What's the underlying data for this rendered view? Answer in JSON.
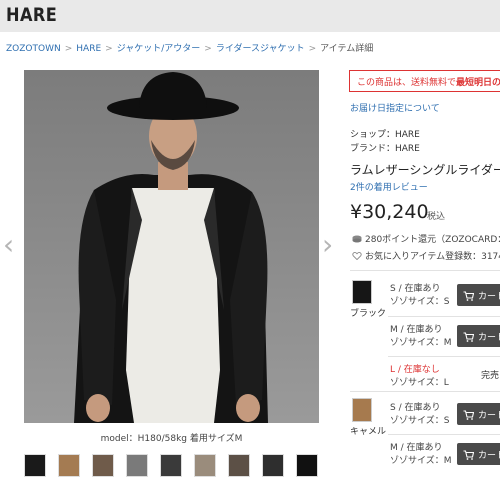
{
  "header": {
    "logo": "HARE"
  },
  "breadcrumb": {
    "items": [
      "ZOZOTOWN",
      "HARE",
      "ジャケット/アウター",
      "ライダースジャケット"
    ],
    "current": "アイテム詳細",
    "separator": ">"
  },
  "gallery": {
    "prev_icon": "chevron-left-icon",
    "next_icon": "chevron-right-icon",
    "caption": "model：H180/58kg 着用サイズM",
    "thumbnail_count": 9
  },
  "product": {
    "notice_prefix": "この商品は、送料無料で",
    "notice_bold": "最短明日のお",
    "delivery_link": "お届け日指定について",
    "shop_line": "ショップ：HARE",
    "brand_line": "ブランド：HARE",
    "name": "ラムレザーシングルライダース",
    "review_link": "2件の着用レビュー",
    "price": "¥30,240",
    "tax_label": "税込",
    "points": "280ポイント還元（ZOZOCARD：",
    "favorites": "お気に入りアイテム登録数：3174"
  },
  "variants": [
    {
      "color": "ブラック",
      "sizes": [
        {
          "status": "S / 在庫あり",
          "size": "ゾゾサイズ：S",
          "action": "カート"
        },
        {
          "status": "M / 在庫あり",
          "size": "ゾゾサイズ：M",
          "action": "カート"
        },
        {
          "status": "L / 在庫なし",
          "size": "ゾゾサイズ：L",
          "action": "完売"
        }
      ]
    },
    {
      "color": "キャメル",
      "sizes": [
        {
          "status": "S / 在庫あり",
          "size": "ゾゾサイズ：S",
          "action": "カート"
        },
        {
          "status": "M / 在庫あり",
          "size": "ゾゾサイズ：M",
          "action": "カート"
        }
      ]
    }
  ],
  "colors": {
    "link": "#2f6fb0",
    "alert": "#dd3333",
    "button": "#4a4a4a"
  }
}
